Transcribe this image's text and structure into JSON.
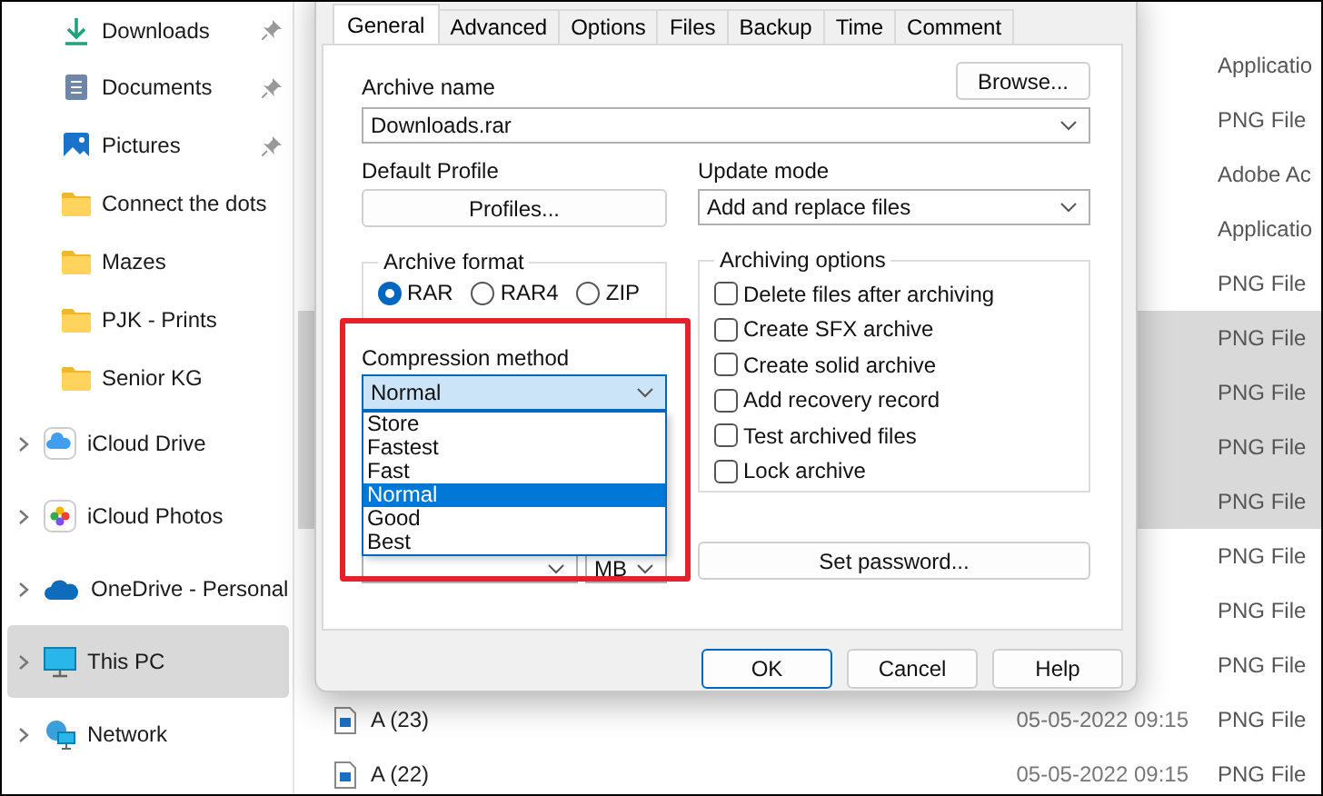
{
  "sidebar": {
    "items": [
      {
        "label": "Downloads",
        "kind": "download",
        "pinned": true,
        "expandable": false,
        "selected": false
      },
      {
        "label": "Documents",
        "kind": "document",
        "pinned": true,
        "expandable": false,
        "selected": false
      },
      {
        "label": "Pictures",
        "kind": "picture",
        "pinned": true,
        "expandable": false,
        "selected": false
      },
      {
        "label": "Connect the dots",
        "kind": "folder",
        "pinned": false,
        "expandable": false,
        "selected": false
      },
      {
        "label": "Mazes",
        "kind": "folder",
        "pinned": false,
        "expandable": false,
        "selected": false
      },
      {
        "label": "PJK - Prints",
        "kind": "folder",
        "pinned": false,
        "expandable": false,
        "selected": false
      },
      {
        "label": "Senior KG",
        "kind": "folder",
        "pinned": false,
        "expandable": false,
        "selected": false
      },
      {
        "label": "iCloud Drive",
        "kind": "cloud",
        "pinned": false,
        "expandable": true,
        "selected": false
      },
      {
        "label": "iCloud Photos",
        "kind": "photos",
        "pinned": false,
        "expandable": true,
        "selected": false
      },
      {
        "label": "OneDrive - Personal",
        "kind": "onedrive",
        "pinned": false,
        "expandable": true,
        "selected": false
      },
      {
        "label": "This PC",
        "kind": "pc",
        "pinned": false,
        "expandable": true,
        "selected": true
      },
      {
        "label": "Network",
        "kind": "network",
        "pinned": false,
        "expandable": true,
        "selected": false
      }
    ]
  },
  "files": {
    "rows": [
      {
        "type": "Applicatio",
        "selected": false
      },
      {
        "type": "PNG File",
        "selected": false
      },
      {
        "type": "Adobe Ac",
        "selected": false
      },
      {
        "type": "Applicatio",
        "selected": false
      },
      {
        "type": "PNG File",
        "selected": false
      },
      {
        "type": "PNG File",
        "selected": true
      },
      {
        "type": "PNG File",
        "selected": true
      },
      {
        "type": "PNG File",
        "selected": true
      },
      {
        "type": "PNG File",
        "selected": true
      },
      {
        "type": "PNG File",
        "selected": false
      },
      {
        "type": "PNG File",
        "selected": false
      },
      {
        "type": "PNG File",
        "selected": false
      },
      {
        "name": "A (23)",
        "date": "05-05-2022 09:15",
        "type": "PNG File",
        "selected": false
      },
      {
        "name": "A (22)",
        "date": "05-05-2022 09:15",
        "type": "PNG File",
        "selected": false
      }
    ]
  },
  "dialog": {
    "tabs": [
      {
        "label": "General",
        "selected": true
      },
      {
        "label": "Advanced",
        "selected": false
      },
      {
        "label": "Options",
        "selected": false
      },
      {
        "label": "Files",
        "selected": false
      },
      {
        "label": "Backup",
        "selected": false
      },
      {
        "label": "Time",
        "selected": false
      },
      {
        "label": "Comment",
        "selected": false
      }
    ],
    "archive_name": {
      "label": "Archive name",
      "value": "Downloads.rar",
      "browse": "Browse..."
    },
    "default_profile": {
      "label": "Default Profile",
      "button": "Profiles..."
    },
    "update_mode": {
      "label": "Update mode",
      "value": "Add and replace files"
    },
    "archive_format": {
      "title": "Archive format",
      "options": [
        {
          "label": "RAR",
          "selected": true
        },
        {
          "label": "RAR4",
          "selected": false
        },
        {
          "label": "ZIP",
          "selected": false
        }
      ]
    },
    "compression_method": {
      "label": "Compression method",
      "value": "Normal",
      "options": [
        {
          "label": "Store",
          "selected": false
        },
        {
          "label": "Fastest",
          "selected": false
        },
        {
          "label": "Fast",
          "selected": false
        },
        {
          "label": "Normal",
          "selected": true
        },
        {
          "label": "Good",
          "selected": false
        },
        {
          "label": "Best",
          "selected": false
        }
      ]
    },
    "dictionary_unit": "MB",
    "archiving_options": {
      "title": "Archiving options",
      "items": [
        {
          "label": "Delete files after archiving",
          "checked": false
        },
        {
          "label": "Create SFX archive",
          "checked": false
        },
        {
          "label": "Create solid archive",
          "checked": false
        },
        {
          "label": "Add recovery record",
          "checked": false
        },
        {
          "label": "Test archived files",
          "checked": false
        },
        {
          "label": "Lock archive",
          "checked": false
        }
      ]
    },
    "set_password": "Set password...",
    "buttons": [
      "OK",
      "Cancel",
      "Help"
    ]
  }
}
